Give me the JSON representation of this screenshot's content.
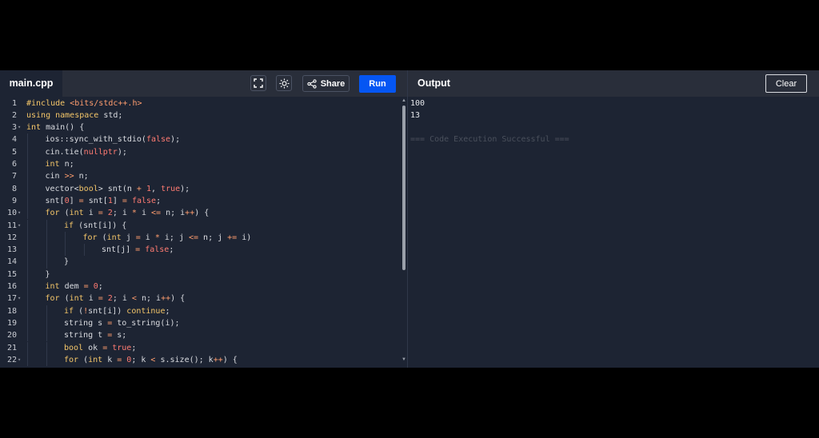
{
  "editor": {
    "file_name": "main.cpp",
    "share_label": "Share",
    "run_label": "Run",
    "lines": [
      {
        "n": "1",
        "fold": false,
        "indent": 0,
        "tokens": [
          [
            "#include ",
            "pp"
          ],
          [
            "<bits/stdc++.h>",
            "str"
          ]
        ]
      },
      {
        "n": "2",
        "fold": false,
        "indent": 0,
        "tokens": [
          [
            "using namespace",
            "kw"
          ],
          [
            " std;",
            "def"
          ]
        ]
      },
      {
        "n": "3",
        "fold": true,
        "indent": 0,
        "tokens": [
          [
            "int",
            "kw"
          ],
          [
            " main() {",
            "def"
          ]
        ]
      },
      {
        "n": "4",
        "fold": false,
        "indent": 1,
        "tokens": [
          [
            "ios::sync_with_stdio(",
            "def"
          ],
          [
            "false",
            "num"
          ],
          [
            ");",
            "def"
          ]
        ]
      },
      {
        "n": "5",
        "fold": false,
        "indent": 1,
        "tokens": [
          [
            "cin.tie(",
            "def"
          ],
          [
            "nullptr",
            "num"
          ],
          [
            ");",
            "def"
          ]
        ]
      },
      {
        "n": "6",
        "fold": false,
        "indent": 1,
        "tokens": [
          [
            "int",
            "kw"
          ],
          [
            " n;",
            "def"
          ]
        ]
      },
      {
        "n": "7",
        "fold": false,
        "indent": 1,
        "tokens": [
          [
            "cin ",
            "def"
          ],
          [
            ">>",
            "op"
          ],
          [
            " n;",
            "def"
          ]
        ]
      },
      {
        "n": "8",
        "fold": false,
        "indent": 1,
        "tokens": [
          [
            "vector<",
            "def"
          ],
          [
            "bool",
            "kw"
          ],
          [
            "> snt(n ",
            "def"
          ],
          [
            "+",
            "op"
          ],
          [
            " ",
            "def"
          ],
          [
            "1",
            "num"
          ],
          [
            ", ",
            "def"
          ],
          [
            "true",
            "num"
          ],
          [
            ");",
            "def"
          ]
        ]
      },
      {
        "n": "9",
        "fold": false,
        "indent": 1,
        "tokens": [
          [
            "snt[",
            "def"
          ],
          [
            "0",
            "num"
          ],
          [
            "] ",
            "def"
          ],
          [
            "=",
            "op"
          ],
          [
            " snt[",
            "def"
          ],
          [
            "1",
            "num"
          ],
          [
            "] ",
            "def"
          ],
          [
            "=",
            "op"
          ],
          [
            " ",
            "def"
          ],
          [
            "false",
            "num"
          ],
          [
            ";",
            "def"
          ]
        ]
      },
      {
        "n": "10",
        "fold": true,
        "indent": 1,
        "tokens": [
          [
            "for",
            "kw"
          ],
          [
            " (",
            "def"
          ],
          [
            "int",
            "kw"
          ],
          [
            " i ",
            "def"
          ],
          [
            "=",
            "op"
          ],
          [
            " ",
            "def"
          ],
          [
            "2",
            "num"
          ],
          [
            "; i ",
            "def"
          ],
          [
            "*",
            "op"
          ],
          [
            " i ",
            "def"
          ],
          [
            "<=",
            "op"
          ],
          [
            " n; i",
            "def"
          ],
          [
            "++",
            "op"
          ],
          [
            ") {",
            "def"
          ]
        ]
      },
      {
        "n": "11",
        "fold": true,
        "indent": 2,
        "tokens": [
          [
            "if",
            "kw"
          ],
          [
            " (snt[i]) {",
            "def"
          ]
        ]
      },
      {
        "n": "12",
        "fold": false,
        "indent": 3,
        "tokens": [
          [
            "for",
            "kw"
          ],
          [
            " (",
            "def"
          ],
          [
            "int",
            "kw"
          ],
          [
            " j ",
            "def"
          ],
          [
            "=",
            "op"
          ],
          [
            " i ",
            "def"
          ],
          [
            "*",
            "op"
          ],
          [
            " i; j ",
            "def"
          ],
          [
            "<=",
            "op"
          ],
          [
            " n; j ",
            "def"
          ],
          [
            "+=",
            "op"
          ],
          [
            " i)",
            "def"
          ]
        ]
      },
      {
        "n": "13",
        "fold": false,
        "indent": 4,
        "tokens": [
          [
            "snt[j] ",
            "def"
          ],
          [
            "=",
            "op"
          ],
          [
            " ",
            "def"
          ],
          [
            "false",
            "num"
          ],
          [
            ";",
            "def"
          ]
        ]
      },
      {
        "n": "14",
        "fold": false,
        "indent": 2,
        "tokens": [
          [
            "}",
            "def"
          ]
        ]
      },
      {
        "n": "15",
        "fold": false,
        "indent": 1,
        "tokens": [
          [
            "}",
            "def"
          ]
        ]
      },
      {
        "n": "16",
        "fold": false,
        "indent": 1,
        "tokens": [
          [
            "int",
            "kw"
          ],
          [
            " dem ",
            "def"
          ],
          [
            "=",
            "op"
          ],
          [
            " ",
            "def"
          ],
          [
            "0",
            "num"
          ],
          [
            ";",
            "def"
          ]
        ]
      },
      {
        "n": "17",
        "fold": true,
        "indent": 1,
        "tokens": [
          [
            "for",
            "kw"
          ],
          [
            " (",
            "def"
          ],
          [
            "int",
            "kw"
          ],
          [
            " i ",
            "def"
          ],
          [
            "=",
            "op"
          ],
          [
            " ",
            "def"
          ],
          [
            "2",
            "num"
          ],
          [
            "; i ",
            "def"
          ],
          [
            "<",
            "op"
          ],
          [
            " n; i",
            "def"
          ],
          [
            "++",
            "op"
          ],
          [
            ") {",
            "def"
          ]
        ]
      },
      {
        "n": "18",
        "fold": false,
        "indent": 2,
        "tokens": [
          [
            "if",
            "kw"
          ],
          [
            " (",
            "def"
          ],
          [
            "!",
            "op"
          ],
          [
            "snt[i]) ",
            "def"
          ],
          [
            "continue",
            "kw"
          ],
          [
            ";",
            "def"
          ]
        ]
      },
      {
        "n": "19",
        "fold": false,
        "indent": 2,
        "tokens": [
          [
            "string s ",
            "def"
          ],
          [
            "=",
            "op"
          ],
          [
            " to_string(i);",
            "def"
          ]
        ]
      },
      {
        "n": "20",
        "fold": false,
        "indent": 2,
        "tokens": [
          [
            "string t ",
            "def"
          ],
          [
            "=",
            "op"
          ],
          [
            " s;",
            "def"
          ]
        ]
      },
      {
        "n": "21",
        "fold": false,
        "indent": 2,
        "tokens": [
          [
            "bool",
            "kw"
          ],
          [
            " ok ",
            "def"
          ],
          [
            "=",
            "op"
          ],
          [
            " ",
            "def"
          ],
          [
            "true",
            "num"
          ],
          [
            ";",
            "def"
          ]
        ]
      },
      {
        "n": "22",
        "fold": true,
        "indent": 2,
        "tokens": [
          [
            "for",
            "kw"
          ],
          [
            " (",
            "def"
          ],
          [
            "int",
            "kw"
          ],
          [
            " k ",
            "def"
          ],
          [
            "=",
            "op"
          ],
          [
            " ",
            "def"
          ],
          [
            "0",
            "num"
          ],
          [
            "; k ",
            "def"
          ],
          [
            "<",
            "op"
          ],
          [
            " s.size(); k",
            "def"
          ],
          [
            "++",
            "op"
          ],
          [
            ") {",
            "def"
          ]
        ]
      }
    ]
  },
  "output": {
    "title": "Output",
    "clear_label": "Clear",
    "lines": [
      "100",
      "13"
    ],
    "status": "=== Code Execution Successful ==="
  },
  "icons": {
    "fullscreen": "expand-icon",
    "theme": "sun-icon",
    "share": "share-icon"
  },
  "colors": {
    "run_button": "#0556f3",
    "keyword": "#f4c669",
    "string": "#ff9d6e",
    "number": "#ff7b72",
    "background": "#1d2433"
  }
}
